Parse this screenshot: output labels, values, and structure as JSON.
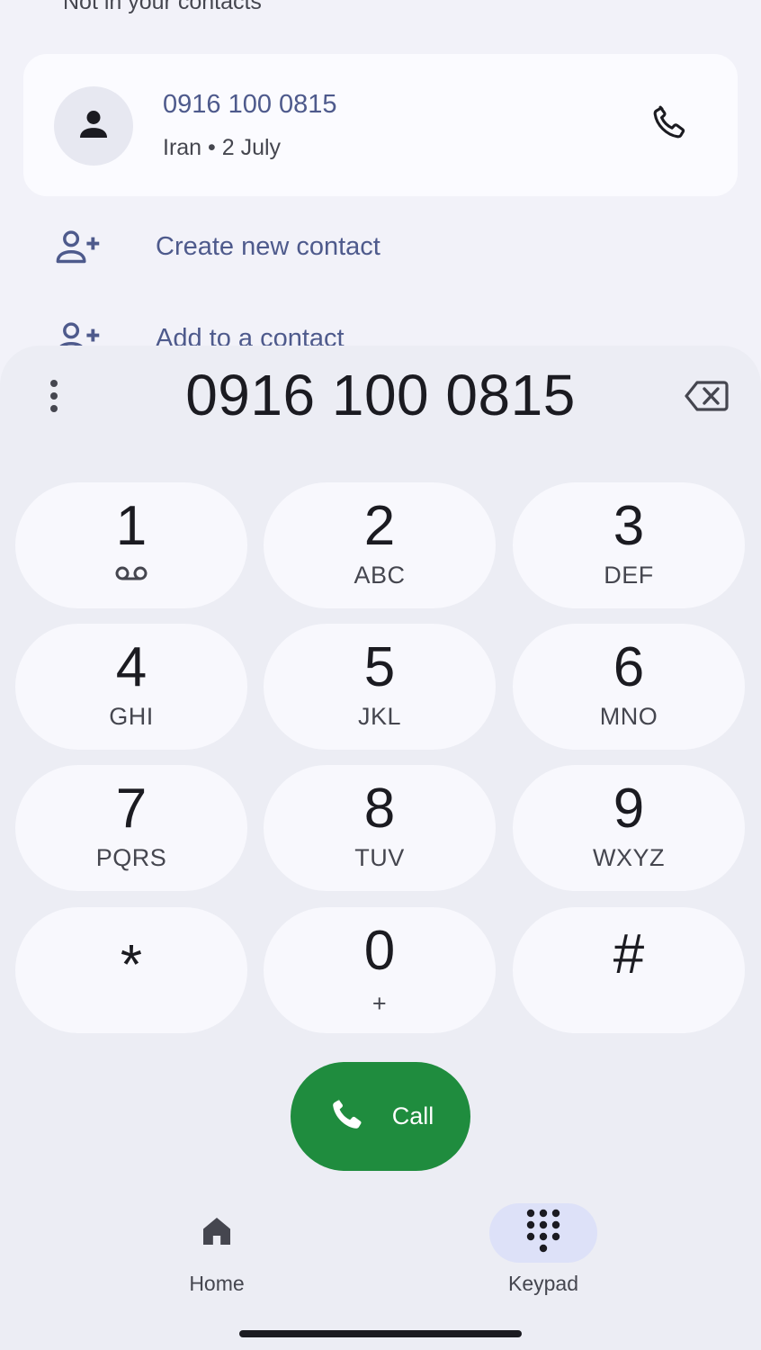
{
  "list": {
    "section_header": "Not in your contacts",
    "card": {
      "number": "0916 100 0815",
      "subtitle": "Iran • 2 July",
      "avatar_icon": "person-icon",
      "call_icon": "phone-icon"
    },
    "actions": [
      {
        "label": "Create new contact",
        "icon": "person-add-icon"
      },
      {
        "label": "Add to a contact",
        "icon": "person-add-icon"
      }
    ]
  },
  "dialer": {
    "typed_number": "0916 100 0815",
    "overflow_icon": "more-vert-icon",
    "backspace_icon": "backspace-icon",
    "keys": [
      {
        "digit": "1",
        "letters": "",
        "sub_icon": "voicemail-icon"
      },
      {
        "digit": "2",
        "letters": "ABC"
      },
      {
        "digit": "3",
        "letters": "DEF"
      },
      {
        "digit": "4",
        "letters": "GHI"
      },
      {
        "digit": "5",
        "letters": "JKL"
      },
      {
        "digit": "6",
        "letters": "MNO"
      },
      {
        "digit": "7",
        "letters": "PQRS"
      },
      {
        "digit": "8",
        "letters": "TUV"
      },
      {
        "digit": "9",
        "letters": "WXYZ"
      },
      {
        "digit": "*",
        "letters": ""
      },
      {
        "digit": "0",
        "letters": "+"
      },
      {
        "digit": "#",
        "letters": ""
      }
    ],
    "call": {
      "label": "Call",
      "icon": "phone-icon"
    }
  },
  "bottom_nav": {
    "items": [
      {
        "label": "Home",
        "icon": "home-icon",
        "active": false
      },
      {
        "label": "Keypad",
        "icon": "dialpad-icon",
        "active": true
      }
    ]
  },
  "colors": {
    "accent_text": "#4e5a8c",
    "call_green": "#1f8c3e",
    "sheet_bg": "#ecedf4",
    "key_bg": "#f8f8fd",
    "active_pill": "#dde1f8"
  }
}
